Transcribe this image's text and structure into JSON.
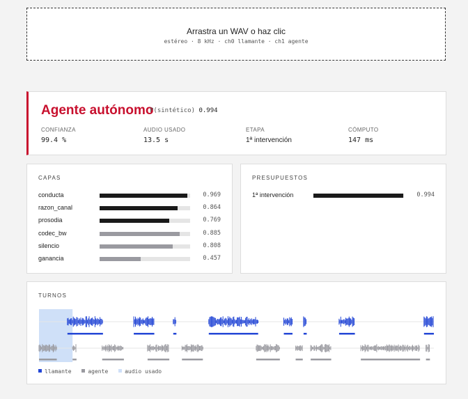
{
  "dropzone": {
    "title": "Arrastra un WAV o haz clic",
    "subtitle": "estéreo · 8 kHz · ch0 llamante · ch1 agente"
  },
  "verdict": {
    "label": "Agente autónomo",
    "p_label": "P(sintético)",
    "p_value": "0.994",
    "accent_color": "#c8102e",
    "metrics": [
      {
        "label": "CONFIANZA",
        "value": "99.4 %",
        "mono": true
      },
      {
        "label": "AUDIO USADO",
        "value": "13.5 s",
        "mono": true
      },
      {
        "label": "ETAPA",
        "value": "1ª intervención",
        "mono": false
      },
      {
        "label": "CÓMPUTO",
        "value": "147 ms",
        "mono": true
      }
    ]
  },
  "layers": {
    "title": "CAPAS",
    "items": [
      {
        "name": "conducta",
        "value": 0.969,
        "label": "0.969",
        "color": "#1a1a1a"
      },
      {
        "name": "razon_canal",
        "value": 0.864,
        "label": "0.864",
        "color": "#1a1a1a"
      },
      {
        "name": "prosodia",
        "value": 0.769,
        "label": "0.769",
        "color": "#1a1a1a"
      },
      {
        "name": "codec_bw",
        "value": 0.885,
        "label": "0.885",
        "color": "#9a9aa0"
      },
      {
        "name": "silencio",
        "value": 0.808,
        "label": "0.808",
        "color": "#9a9aa0"
      },
      {
        "name": "ganancia",
        "value": 0.457,
        "label": "0.457",
        "color": "#9a9aa0"
      }
    ]
  },
  "budgets": {
    "title": "PRESUPUESTOS",
    "items": [
      {
        "name": "1ª intervención",
        "value": 0.994,
        "label": "0.994",
        "color": "#1a1a1a"
      }
    ]
  },
  "turns": {
    "title": "TURNOS",
    "caller_color": "#2447d6",
    "agent_color": "#9a9aa0",
    "used_color": "#cfe0f8",
    "used_fraction": 0.085,
    "caller_segments": [
      [
        0.072,
        0.162
      ],
      [
        0.24,
        0.292
      ],
      [
        0.34,
        0.348
      ],
      [
        0.43,
        0.555
      ],
      [
        0.62,
        0.642
      ],
      [
        0.67,
        0.678
      ],
      [
        0.76,
        0.8
      ],
      [
        0.975,
        1.0
      ]
    ],
    "agent_segments": [
      [
        0.0,
        0.045
      ],
      [
        0.085,
        0.095
      ],
      [
        0.16,
        0.215
      ],
      [
        0.275,
        0.33
      ],
      [
        0.362,
        0.415
      ],
      [
        0.55,
        0.61
      ],
      [
        0.65,
        0.668
      ],
      [
        0.688,
        0.74
      ],
      [
        0.815,
        0.965
      ],
      [
        0.98,
        0.99
      ]
    ],
    "legend": {
      "caller": "llamante",
      "agent": "agente",
      "used": "audio usado"
    }
  }
}
